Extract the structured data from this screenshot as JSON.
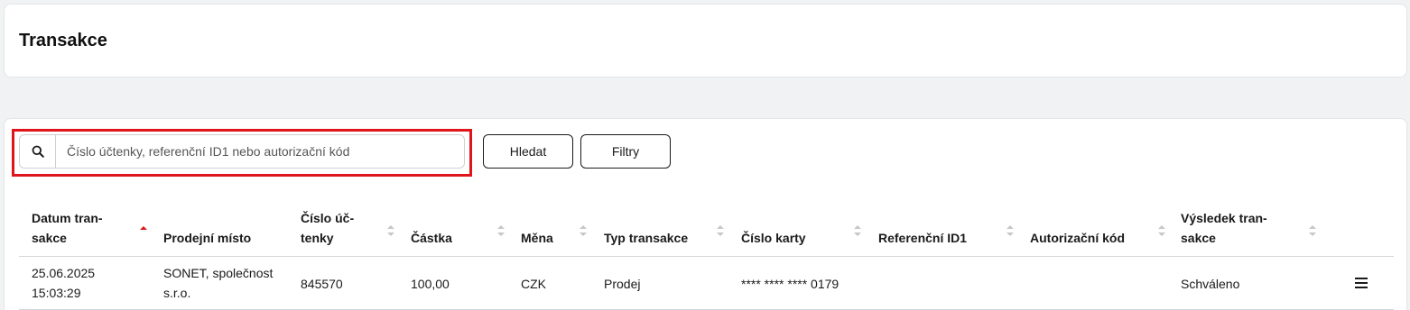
{
  "page": {
    "title": "Transakce"
  },
  "search": {
    "placeholder": "Číslo účtenky, referenční ID1 nebo autorizační kód",
    "value": "",
    "icon": "search-icon",
    "search_button": "Hledat",
    "filter_button": "Filtry",
    "highlight_color": "#e0151b"
  },
  "table": {
    "columns": [
      {
        "label_line1": "Datum tran-",
        "label_line2": "sakce",
        "sort": "ascending"
      },
      {
        "label_line1": "",
        "label_line2": "Prodejní místo",
        "sort": "none"
      },
      {
        "label_line1": "Číslo úč-",
        "label_line2": "tenky",
        "sort": "sortable"
      },
      {
        "label_line1": "",
        "label_line2": "Částka",
        "sort": "sortable"
      },
      {
        "label_line1": "",
        "label_line2": "Měna",
        "sort": "sortable"
      },
      {
        "label_line1": "",
        "label_line2": "Typ transakce",
        "sort": "sortable"
      },
      {
        "label_line1": "",
        "label_line2": "Číslo karty",
        "sort": "sortable"
      },
      {
        "label_line1": "",
        "label_line2": "Referenční ID1",
        "sort": "sortable"
      },
      {
        "label_line1": "",
        "label_line2": "Autorizační kód",
        "sort": "sortable"
      },
      {
        "label_line1": "Výsledek tran-",
        "label_line2": "sakce",
        "sort": "sortable"
      }
    ],
    "rows": [
      {
        "date": "25.06.2025",
        "time": "15:03:29",
        "pos_line1": "SONET, společnost",
        "pos_line2": "s.r.o.",
        "receipt": "845570",
        "amount": "100,00",
        "currency": "CZK",
        "type": "Prodej",
        "card": "**** **** **** 0179",
        "ref_id": "",
        "auth_code": "",
        "result": "Schváleno",
        "actions_icon": "menu-icon"
      }
    ]
  },
  "colors": {
    "sort_active": "#e0151b",
    "sort_inactive": "#c4c7cc"
  }
}
